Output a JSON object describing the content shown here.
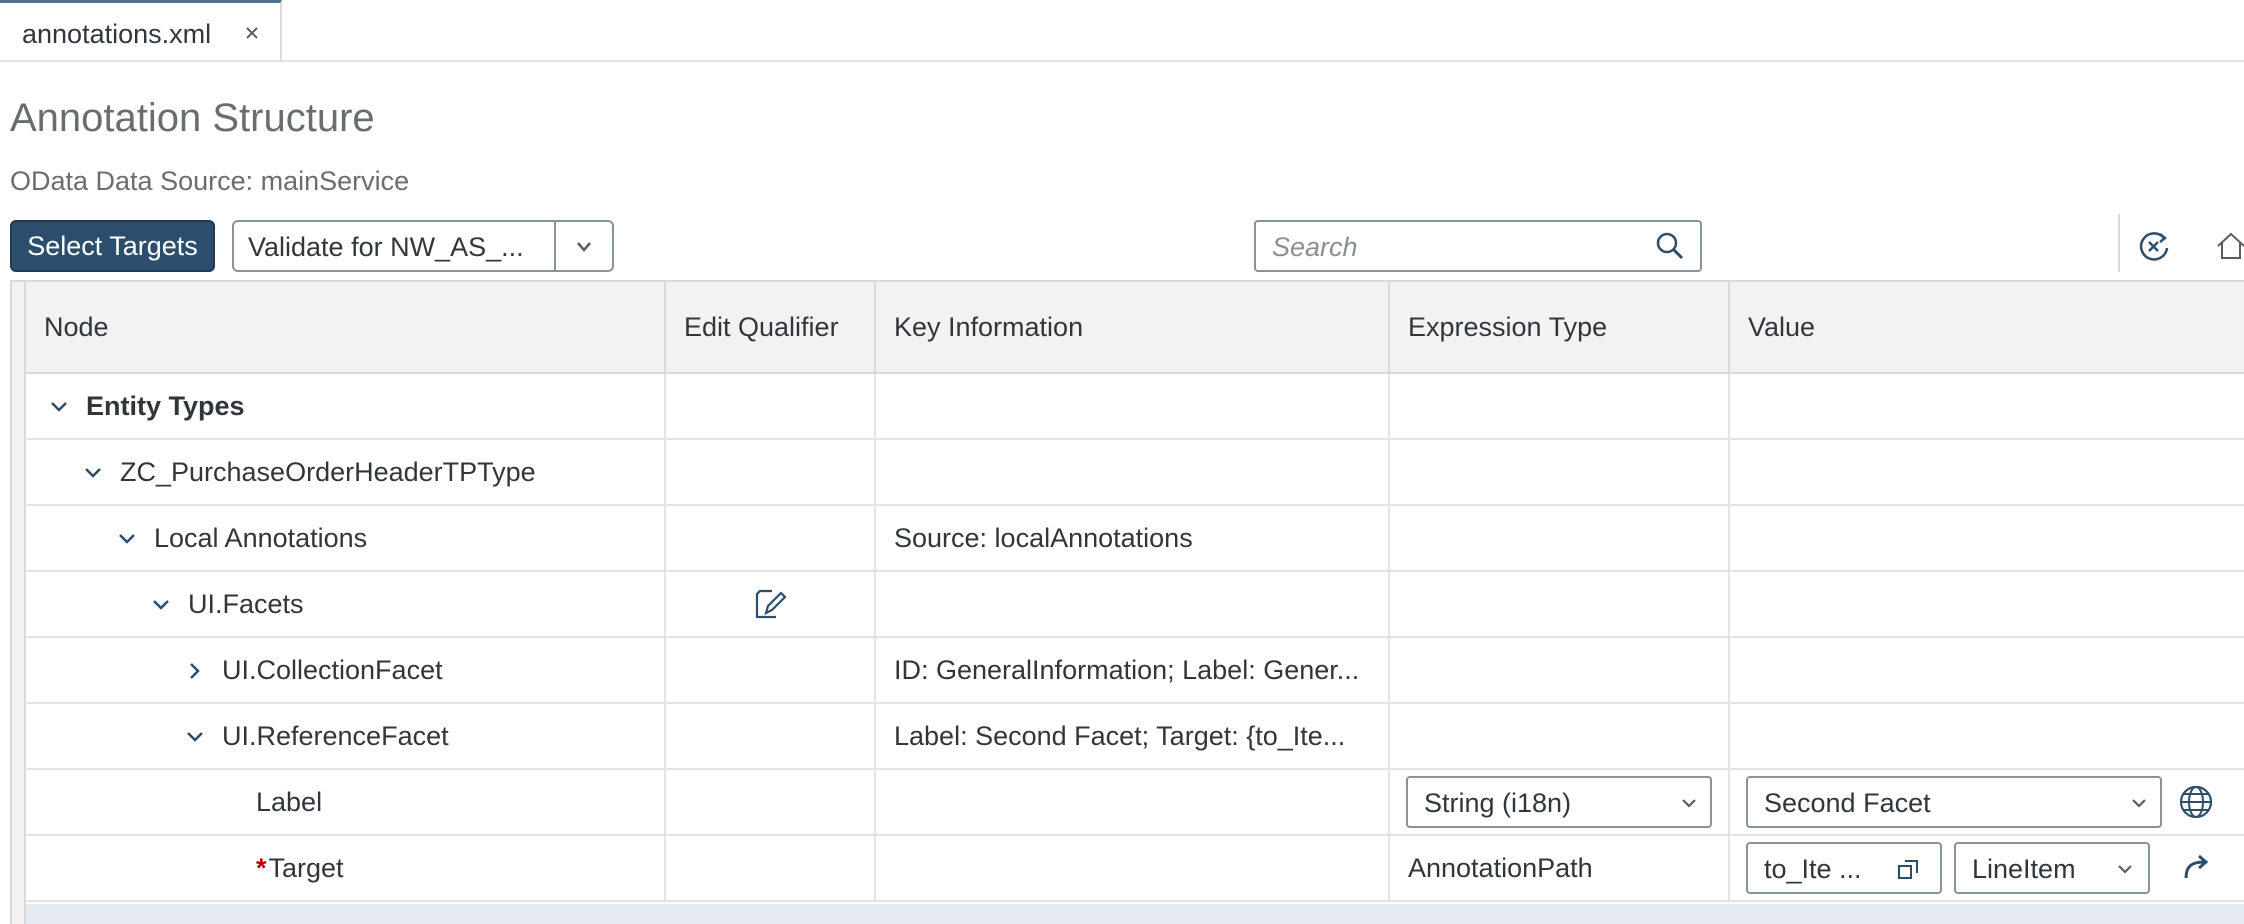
{
  "tabs": [
    {
      "label": "annotations.xml",
      "close_icon": "close-icon"
    }
  ],
  "header": {
    "title": "Annotation Structure",
    "subtitle": "OData Data Source: mainService"
  },
  "toolbar": {
    "select_targets_label": "Select Targets",
    "validate_value": "Validate for NW_AS_...",
    "search_placeholder": "Search",
    "icons": [
      "chevron-down-icon",
      "search-icon",
      "clear-filter-icon",
      "home-icon"
    ]
  },
  "table": {
    "columns": [
      "Node",
      "Edit Qualifier",
      "Key Information",
      "Expression Type",
      "Value"
    ],
    "rows": [
      {
        "node": "Entity Types",
        "key": "",
        "expression": "",
        "value": ""
      },
      {
        "node": "ZC_PurchaseOrderHeaderTPType",
        "key": "",
        "expression": "",
        "value": ""
      },
      {
        "node": "Local Annotations",
        "key": "Source: localAnnotations",
        "expression": "",
        "value": ""
      },
      {
        "node": "UI.Facets",
        "key": "",
        "expression": "",
        "value": ""
      },
      {
        "node": "UI.CollectionFacet",
        "key": "ID: GeneralInformation; Label: Gener...",
        "expression": "",
        "value": ""
      },
      {
        "node": "UI.ReferenceFacet",
        "key": "Label: Second Facet; Target: {to_Ite...",
        "expression": "",
        "value": ""
      },
      {
        "node": "Label",
        "key": "",
        "expression": "String (i18n)",
        "value": "Second Facet"
      },
      {
        "node": "Target",
        "required_marker": "*",
        "key": "",
        "expression": "AnnotationPath",
        "value": "to_Ite ...",
        "value2": "LineItem"
      }
    ]
  },
  "colors": {
    "primary_button": "#2c4e6c",
    "tab_accent": "#4a6f95",
    "required": "#bb0000",
    "header_bg": "#f2f2f2"
  }
}
